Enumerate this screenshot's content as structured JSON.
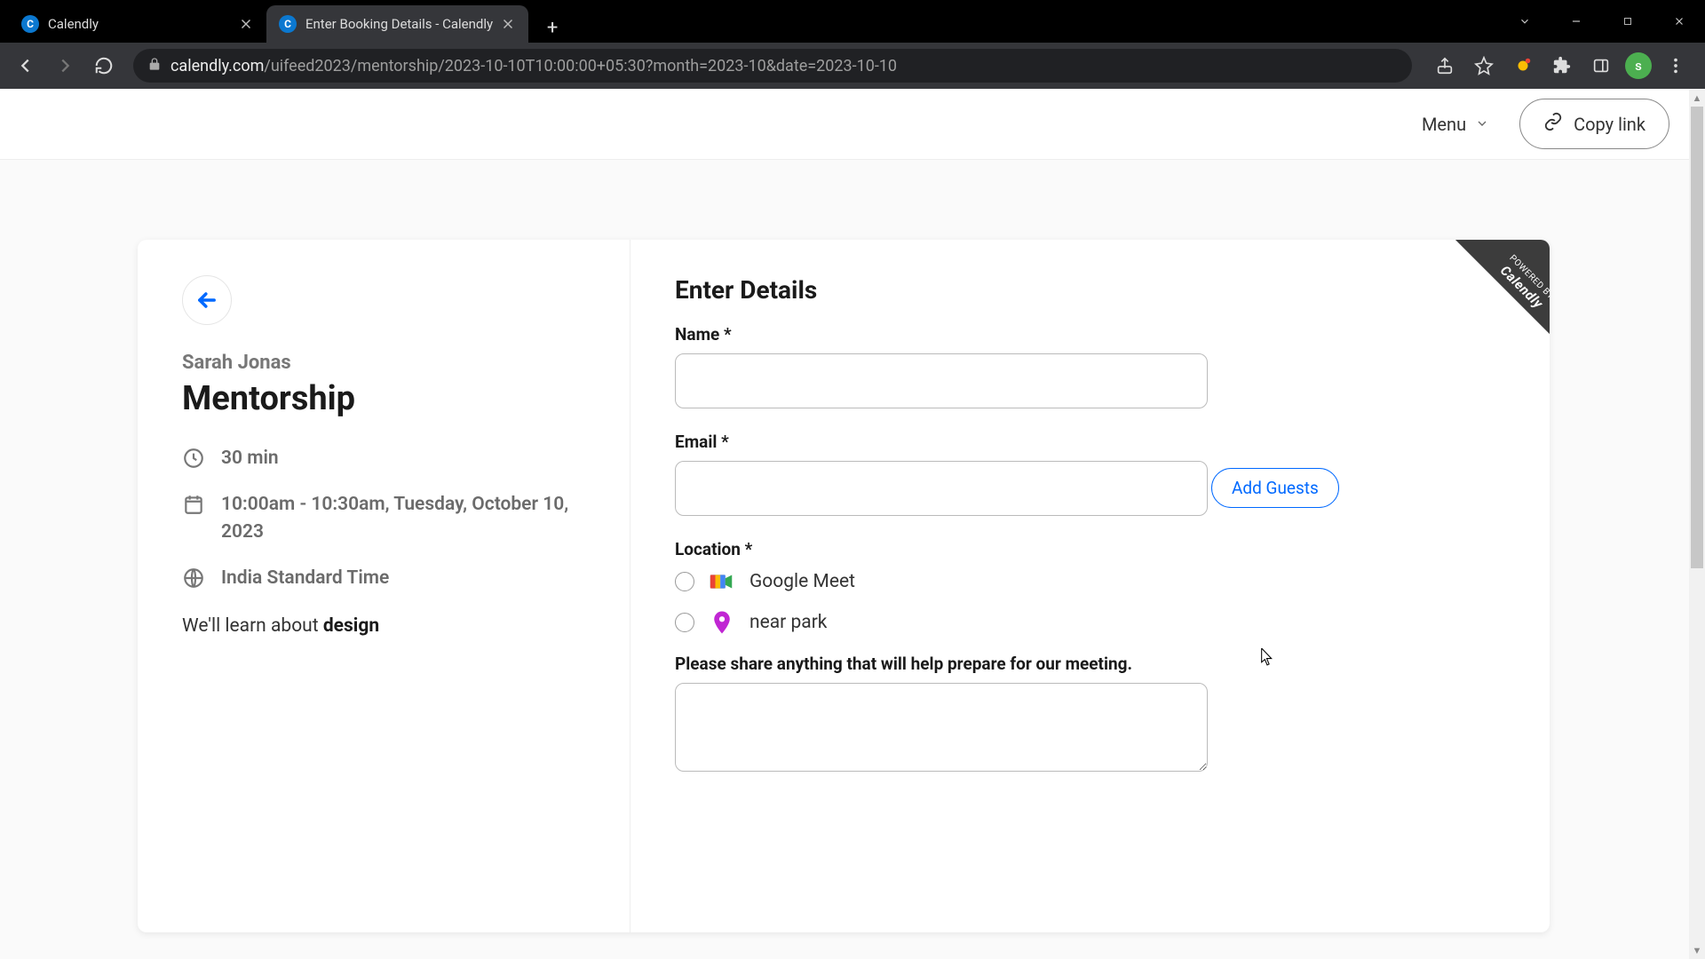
{
  "browser": {
    "tabs": [
      {
        "title": "Calendly",
        "active": false
      },
      {
        "title": "Enter Booking Details - Calendly",
        "active": true
      }
    ],
    "url_domain": "calendly.com",
    "url_path": "/uifeed2023/mentorship/2023-10-10T10:00:00+05:30?month=2023-10&date=2023-10-10",
    "avatar_letter": "s"
  },
  "header": {
    "menu_label": "Menu",
    "copy_link_label": "Copy link"
  },
  "event": {
    "host_name": "Sarah Jonas",
    "title": "Mentorship",
    "duration": "30 min",
    "time_range": "10:00am - 10:30am, Tuesday, October 10, 2023",
    "timezone": "India Standard Time",
    "description_prefix": "We'll learn about ",
    "description_bold": "design"
  },
  "form": {
    "title": "Enter Details",
    "name_label": "Name *",
    "name_value": "",
    "email_label": "Email *",
    "email_value": "",
    "add_guests_label": "Add Guests",
    "location_label": "Location *",
    "locations": [
      {
        "label": "Google Meet",
        "icon": "google-meet"
      },
      {
        "label": "near park",
        "icon": "pin"
      }
    ],
    "notes_label": "Please share anything that will help prepare for our meeting.",
    "notes_value": ""
  },
  "powered": {
    "line1": "POWERED BY",
    "line2": "Calendly"
  }
}
